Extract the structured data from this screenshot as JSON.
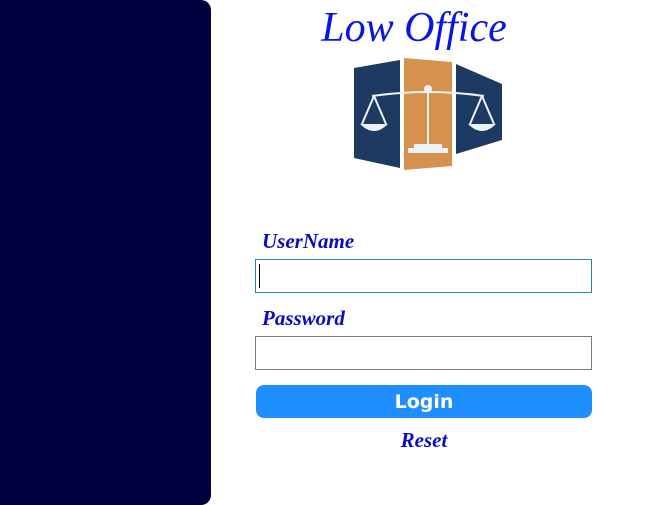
{
  "app": {
    "title": "Low Office"
  },
  "logo": {
    "icon": "scales-of-justice-icon",
    "colors": {
      "navy": "#1d3a63",
      "tan": "#d4924e",
      "light": "#eef2f6"
    }
  },
  "form": {
    "username_label": "UserName",
    "username_value": "",
    "password_label": "Password",
    "password_value": "",
    "login_label": "Login",
    "reset_label": "Reset"
  },
  "colors": {
    "sidebar": "#000040",
    "accent_button": "#1f8eff",
    "label_text": "#0a0ac8",
    "title_text": "#0a14e6"
  }
}
